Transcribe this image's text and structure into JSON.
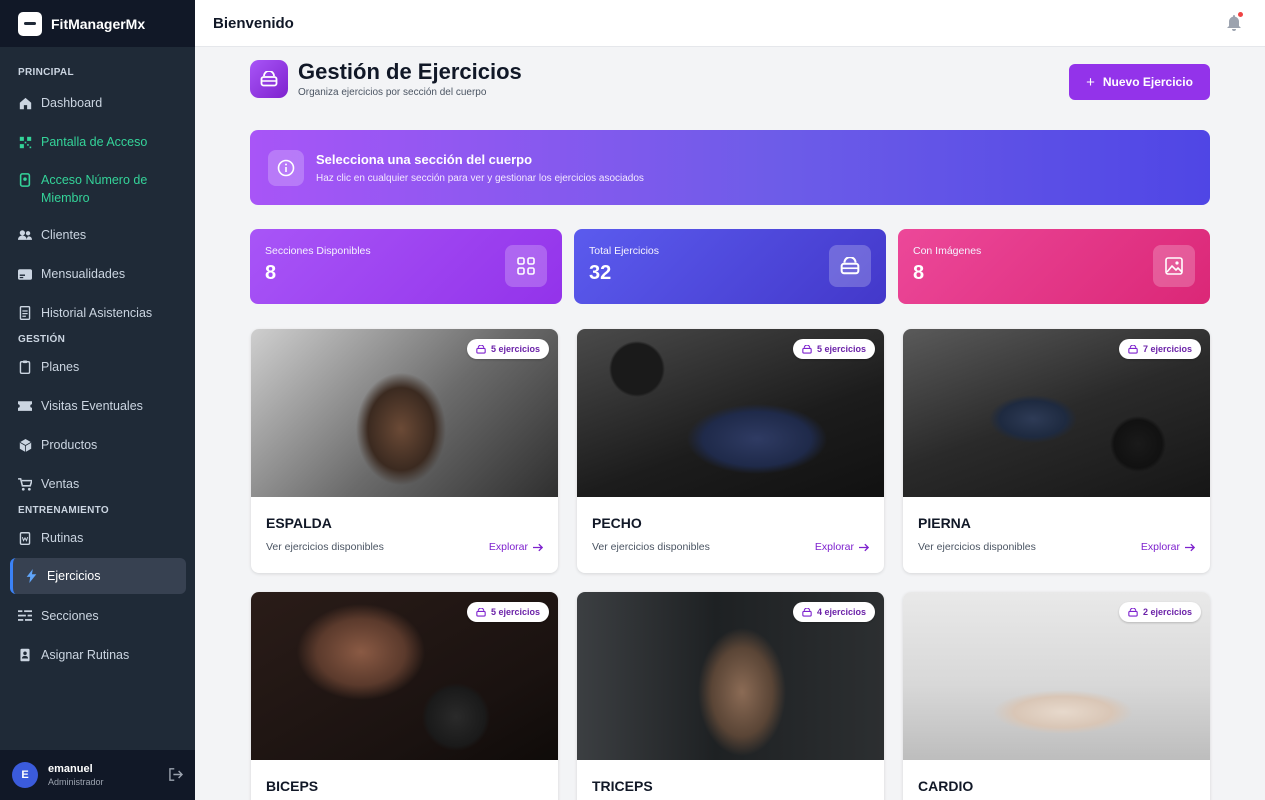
{
  "app": {
    "name": "FitManagerMx"
  },
  "topbar": {
    "title": "Bienvenido"
  },
  "sidebar": {
    "sections": {
      "principal": "PRINCIPAL",
      "gestion": "GESTIÓN",
      "entrenamiento": "ENTRENAMIENTO"
    },
    "items": [
      {
        "label": "Dashboard",
        "icon": "home-icon"
      },
      {
        "label": "Pantalla de Acceso",
        "icon": "qr-code-icon"
      },
      {
        "label": "Acceso Número de Miembro",
        "icon": "id-badge-icon"
      },
      {
        "label": "Clientes",
        "icon": "users-icon"
      },
      {
        "label": "Mensualidades",
        "icon": "card-icon"
      },
      {
        "label": "Historial Asistencias",
        "icon": "history-icon"
      },
      {
        "label": "Planes",
        "icon": "clipboard-icon"
      },
      {
        "label": "Visitas Eventuales",
        "icon": "ticket-icon"
      },
      {
        "label": "Productos",
        "icon": "box-icon"
      },
      {
        "label": "Ventas",
        "icon": "cart-icon"
      },
      {
        "label": "Rutinas",
        "icon": "routine-icon"
      },
      {
        "label": "Ejercicios",
        "icon": "bolt-icon"
      },
      {
        "label": "Secciones",
        "icon": "sections-icon"
      },
      {
        "label": "Asignar Rutinas",
        "icon": "assign-icon"
      }
    ],
    "user": {
      "initial": "E",
      "name": "emanuel",
      "role": "Administrador"
    }
  },
  "page": {
    "title": "Gestión de Ejercicios",
    "subtitle": "Organiza ejercicios por sección del cuerpo",
    "new_button": "Nuevo Ejercicio"
  },
  "banner": {
    "title": "Selecciona una sección del cuerpo",
    "text": "Haz clic en cualquier sección para ver y gestionar los ejercicios asociados"
  },
  "stats": [
    {
      "label": "Secciones Disponibles",
      "value": "8"
    },
    {
      "label": "Total Ejercicios",
      "value": "32"
    },
    {
      "label": "Con Imágenes",
      "value": "8"
    }
  ],
  "cards": [
    {
      "title": "ESPALDA",
      "badge": "5 ejercicios",
      "desc": "Ver ejercicios disponibles",
      "link": "Explorar"
    },
    {
      "title": "PECHO",
      "badge": "5 ejercicios",
      "desc": "Ver ejercicios disponibles",
      "link": "Explorar"
    },
    {
      "title": "PIERNA",
      "badge": "7 ejercicios",
      "desc": "Ver ejercicios disponibles",
      "link": "Explorar"
    },
    {
      "title": "BICEPS",
      "badge": "5 ejercicios",
      "desc": "",
      "link": ""
    },
    {
      "title": "TRICEPS",
      "badge": "4 ejercicios",
      "desc": "",
      "link": ""
    },
    {
      "title": "CARDIO",
      "badge": "2 ejercicios",
      "desc": "",
      "link": ""
    }
  ],
  "colors": {
    "sidebar": "#1f2a37",
    "accent": "#9333ea",
    "stat_purple": "#9333ea",
    "stat_indigo": "#4f46e5",
    "stat_pink": "#db2777"
  }
}
